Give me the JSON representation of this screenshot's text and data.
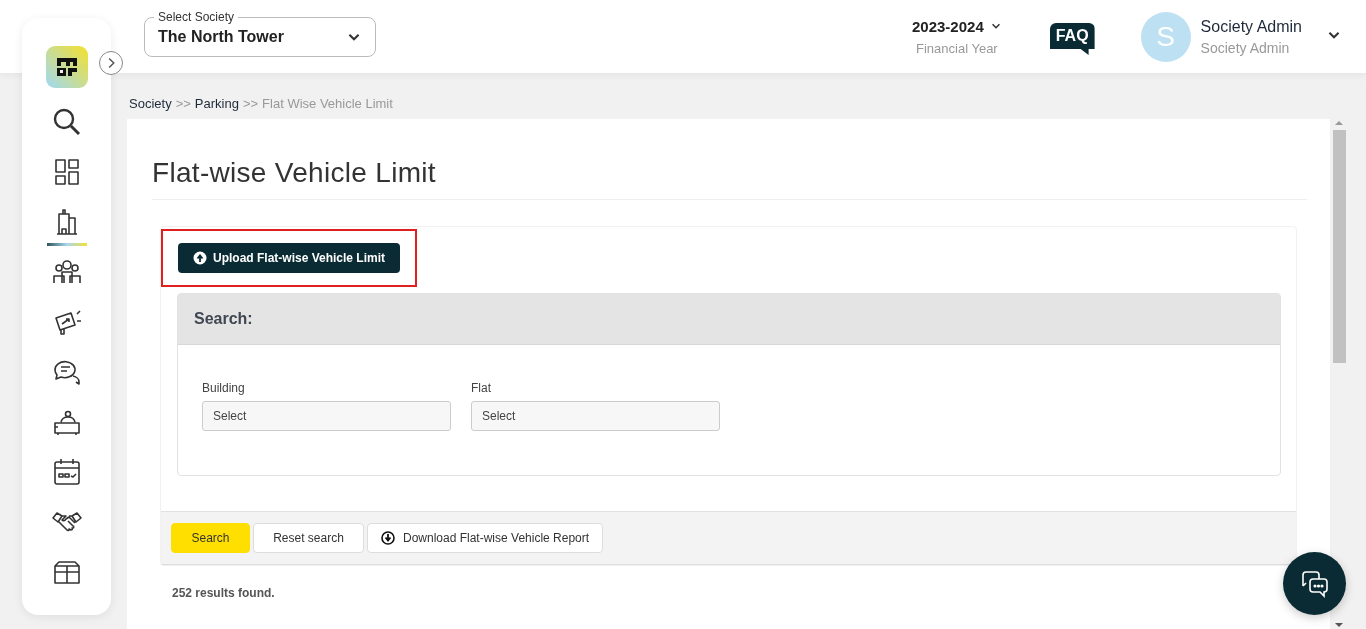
{
  "sidebar": {
    "items": [
      {
        "selected": false
      },
      {
        "selected": true
      },
      {
        "selected": false
      },
      {
        "selected": false
      },
      {
        "selected": false
      },
      {
        "selected": false
      },
      {
        "selected": false
      },
      {
        "selected": false
      },
      {
        "selected": false
      }
    ]
  },
  "header": {
    "society_select": {
      "label": "Select Society",
      "value": "The North Tower"
    },
    "financial_year": {
      "value": "2023-2024",
      "label": "Financial Year"
    },
    "faq": "FAQ",
    "user": {
      "initial": "S",
      "name": "Society Admin",
      "role": "Society Admin"
    }
  },
  "breadcrumb": {
    "items": [
      {
        "label": "Society",
        "current": false
      },
      {
        "label": "Parking",
        "current": false
      },
      {
        "label": "Flat Wise Vehicle Limit",
        "current": true
      }
    ],
    "separators": [
      ">>",
      ">>"
    ]
  },
  "page_title": "Flat-wise Vehicle Limit",
  "upload_button": {
    "label": "Upload Flat-wise Vehicle Limit",
    "highlighted": true
  },
  "search_panel": {
    "title": "Search:",
    "fields": [
      {
        "label": "Building",
        "placeholder": "Select"
      },
      {
        "label": "Flat",
        "placeholder": "Select"
      }
    ]
  },
  "actions": [
    {
      "kind": "primary",
      "label": "Search"
    },
    {
      "kind": "plain",
      "label": "Reset search"
    },
    {
      "kind": "download",
      "label": "Download Flat-wise Vehicle Report"
    }
  ],
  "results": "252 results found."
}
